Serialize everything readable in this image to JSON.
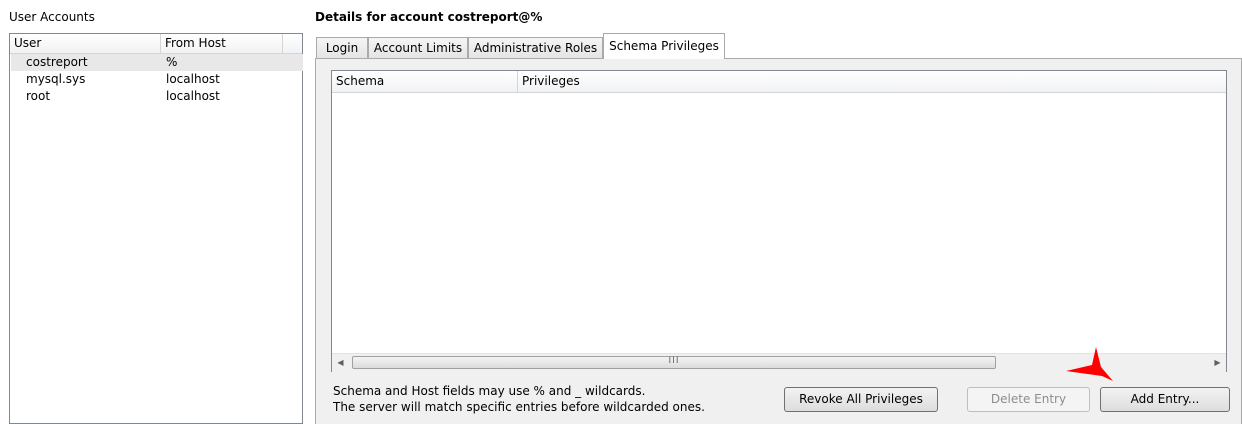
{
  "users_panel": {
    "title": "User Accounts",
    "columns": [
      "User",
      "From Host"
    ],
    "rows": [
      {
        "user": "costreport",
        "host": "%"
      },
      {
        "user": "mysql.sys",
        "host": "localhost"
      },
      {
        "user": "root",
        "host": "localhost"
      }
    ]
  },
  "details": {
    "title": "Details for account costreport@%"
  },
  "tabs": [
    "Login",
    "Account Limits",
    "Administrative Roles",
    "Schema Privileges"
  ],
  "privileges_table": {
    "columns": [
      "Schema",
      "Privileges"
    ],
    "scroll_left_glyph": "◀",
    "scroll_right_glyph": "▶",
    "scroll_grip": "III"
  },
  "info": {
    "line1": "Schema and Host fields may use % and _ wildcards.",
    "line2": "The server will match specific entries before wildcarded ones."
  },
  "buttons": {
    "revoke_all": "Revoke All Privileges",
    "delete_entry": "Delete Entry",
    "add_entry": "Add Entry..."
  },
  "colors": {
    "annotation_arrow": "#ff0000",
    "selected_row": "#e8e8e8"
  }
}
